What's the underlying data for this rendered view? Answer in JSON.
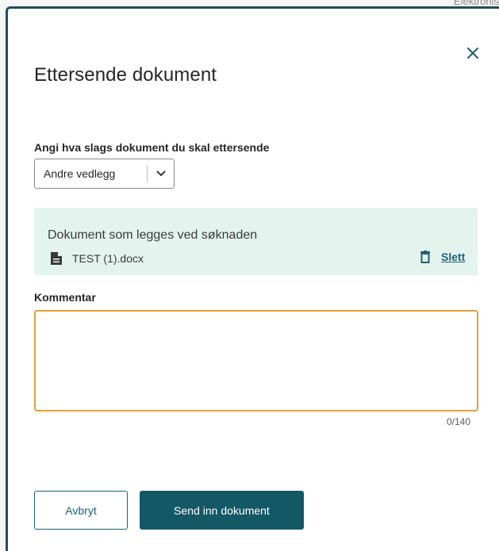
{
  "background": {
    "partial_text": "Elektronis"
  },
  "modal": {
    "title": "Ettersende dokument",
    "close_icon": "close-icon"
  },
  "document_type": {
    "label": "Angi hva slags dokument du skal ettersende",
    "selected": "Andre vedlegg",
    "icon": "chevron-down-icon"
  },
  "attached": {
    "heading": "Dokument som legges ved søknaden",
    "file_icon": "file-icon",
    "file_name": "TEST (1).docx",
    "delete_icon": "trash-icon",
    "delete_label": "Slett"
  },
  "comment": {
    "label": "Kommentar",
    "value": "",
    "counter": "0/140"
  },
  "actions": {
    "cancel_label": "Avbryt",
    "submit_label": "Send inn dokument"
  },
  "colors": {
    "primary": "#145866",
    "link": "#1f5f73",
    "focus_border": "#e0a03a",
    "info_box_bg": "#e3f4ef"
  }
}
